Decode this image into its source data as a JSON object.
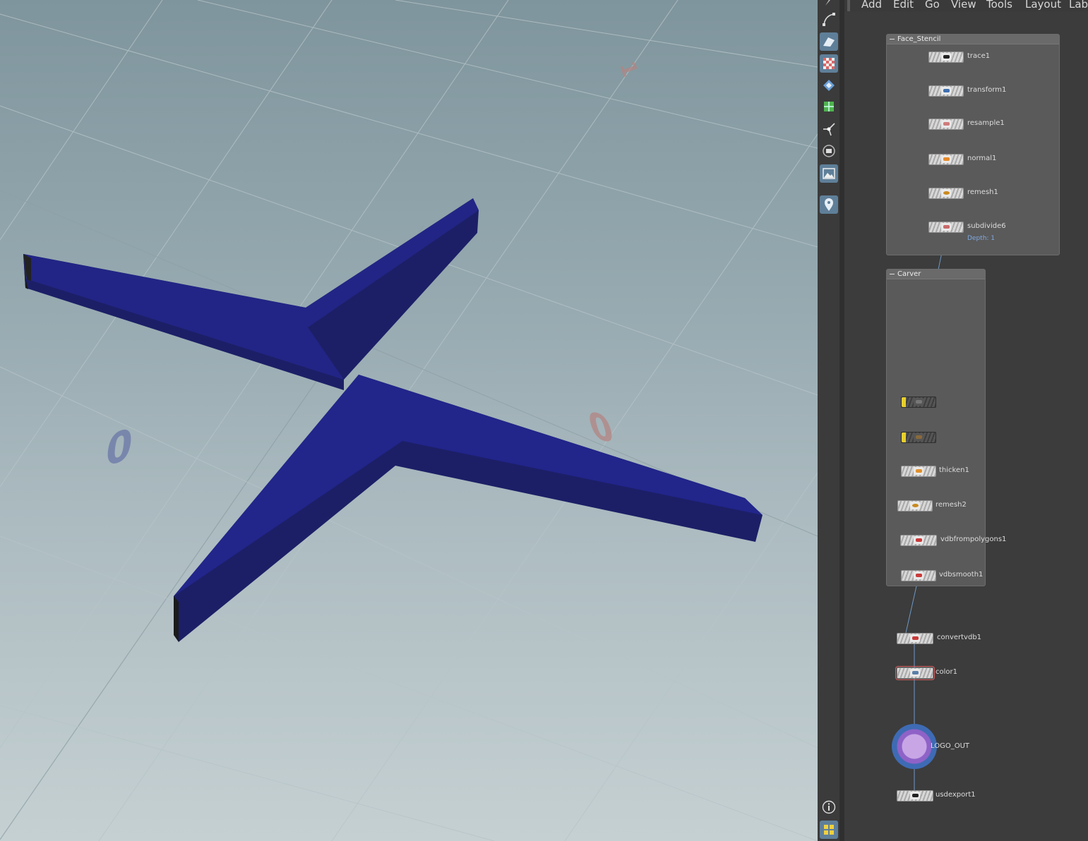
{
  "menubar": {
    "items": [
      "Add",
      "Edit",
      "Go",
      "View",
      "Tools",
      "Layout",
      "Labs"
    ]
  },
  "viewport": {
    "ground_numbers": [
      "0",
      "1"
    ]
  },
  "shelf": {
    "tools": [
      {
        "name": "bezier-curve-tool-icon",
        "active": false
      },
      {
        "name": "view-tool-icon",
        "active": true
      },
      {
        "name": "checker-display-icon",
        "active": true
      },
      {
        "name": "diamond-snap-icon",
        "active": false
      },
      {
        "name": "green-grid-icon",
        "active": false
      },
      {
        "name": "transform-handle-icon",
        "active": false
      },
      {
        "name": "display-options-icon",
        "active": false
      },
      {
        "name": "background-image-icon",
        "active": true
      },
      {
        "name": "location-pin-icon",
        "active": true
      },
      {
        "name": "info-icon",
        "active": false
      },
      {
        "name": "viewport-layout-icon",
        "active": true
      }
    ]
  },
  "network": {
    "boxes": [
      {
        "id": "face_stencil",
        "title": "Face_Stencil"
      },
      {
        "id": "carver",
        "title": "Carver"
      }
    ],
    "nodes": [
      {
        "id": "trace1",
        "label": "trace1",
        "icon_color": "#222222"
      },
      {
        "id": "transform1",
        "label": "transform1",
        "icon_color": "#3f6fae"
      },
      {
        "id": "resample1",
        "label": "resample1",
        "icon_color": "#cf7c7c"
      },
      {
        "id": "normal1",
        "label": "normal1",
        "icon_color": "#e58a2b"
      },
      {
        "id": "remesh1",
        "label": "remesh1",
        "icon_color": "#c98a1f"
      },
      {
        "id": "subdivide6",
        "label": "subdivide6",
        "icon_color": "#c86a6a",
        "sublabel": "Depth: 1"
      },
      {
        "id": "carver_a",
        "label": "",
        "icon_color": "#666666"
      },
      {
        "id": "carver_b",
        "label": "",
        "icon_color": "#8a6a3a"
      },
      {
        "id": "thicken1",
        "label": "thicken1",
        "icon_color": "#e0902c"
      },
      {
        "id": "remesh2",
        "label": "remesh2",
        "icon_color": "#c98a1f"
      },
      {
        "id": "vdbfrompolygons1",
        "label": "vdbfrompolygons1",
        "icon_color": "#c93a3a"
      },
      {
        "id": "vdbsmooth1",
        "label": "vdbsmooth1",
        "icon_color": "#c93a3a"
      },
      {
        "id": "convertvdb1",
        "label": "convertvdb1",
        "icon_color": "#c93a3a"
      },
      {
        "id": "color1",
        "label": "color1",
        "icon_color": "#5a7fa8"
      },
      {
        "id": "logo_out",
        "label": "LOGO_OUT",
        "icon_color": "#8f62c7"
      },
      {
        "id": "usdexport1",
        "label": "usdexport1",
        "icon_color": "#222222"
      }
    ]
  }
}
